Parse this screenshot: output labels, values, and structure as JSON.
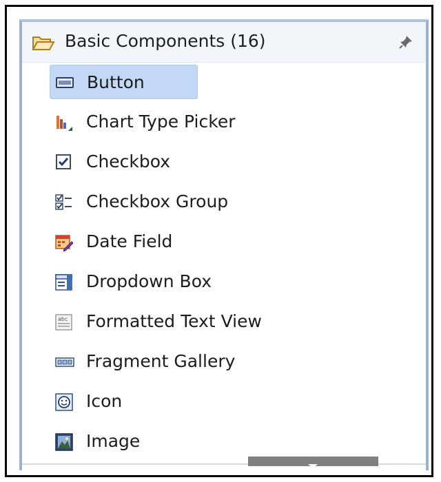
{
  "panel": {
    "title": "Basic Components (16)",
    "header_icon": "folder-open-icon",
    "pin_icon": "pin-icon"
  },
  "items": [
    {
      "label": "Button",
      "icon": "button-icon",
      "selected": true
    },
    {
      "label": "Chart Type Picker",
      "icon": "chart-type-picker-icon",
      "selected": false
    },
    {
      "label": "Checkbox",
      "icon": "checkbox-icon",
      "selected": false
    },
    {
      "label": "Checkbox Group",
      "icon": "checkbox-group-icon",
      "selected": false
    },
    {
      "label": "Date Field",
      "icon": "date-field-icon",
      "selected": false
    },
    {
      "label": "Dropdown Box",
      "icon": "dropdown-box-icon",
      "selected": false
    },
    {
      "label": "Formatted Text View",
      "icon": "formatted-text-view-icon",
      "selected": false
    },
    {
      "label": "Fragment Gallery",
      "icon": "fragment-gallery-icon",
      "selected": false
    },
    {
      "label": "Icon",
      "icon": "smiley-icon",
      "selected": false
    },
    {
      "label": "Image",
      "icon": "image-icon",
      "selected": false
    }
  ],
  "colors": {
    "selection": "#c2d8f4",
    "panel_border": "#9bb2cf",
    "header_bg": "#f2f6fb",
    "scroll_thumb": "#7f7f7f"
  }
}
